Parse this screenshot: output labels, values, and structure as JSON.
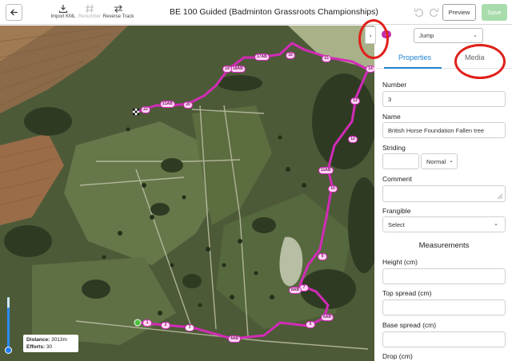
{
  "toolbar": {
    "import_kml_label": "Import KML",
    "renumber_label": "Renumber",
    "reverse_track_label": "Reverse Track",
    "title": "BE 100 Guided (Badminton Grassroots Championships)",
    "preview_label": "Preview",
    "save_label": "Save"
  },
  "map": {
    "stats": {
      "distance_label": "Distance:",
      "distance_value": "3013m",
      "efforts_label": "Efforts:",
      "efforts_value": "30"
    },
    "zoom_level": 0.82,
    "route_markers": [
      "1",
      "2",
      "3",
      "4AB",
      "5",
      "6AB",
      "7",
      "8AB",
      "9",
      "10",
      "11AB",
      "12",
      "13",
      "14",
      "15",
      "16",
      "17AB",
      "18AB",
      "19",
      "20",
      "21AB",
      "22"
    ]
  },
  "panel": {
    "collapse_icon": "›",
    "selected_badge": "3",
    "obstacle_type": "Jump",
    "tabs": {
      "properties": "Properties",
      "media": "Media"
    },
    "fields": {
      "number_label": "Number",
      "number_value": "3",
      "name_label": "Name",
      "name_value": "British Horse Foundation Fallen tree",
      "striding_label": "Striding",
      "striding_option": "Normal",
      "comment_label": "Comment",
      "frangible_label": "Frangible",
      "frangible_placeholder": "Select",
      "measurements_title": "Measurements",
      "height_label": "Height (cm)",
      "top_spread_label": "Top spread (cm)",
      "base_spread_label": "Base spread (cm)",
      "drop_label": "Drop (cm)"
    }
  },
  "colors": {
    "route": "#d22bb7",
    "accent": "#1f82d0",
    "save_disabled": "#a8dcad",
    "annotation": "#e0201a"
  }
}
